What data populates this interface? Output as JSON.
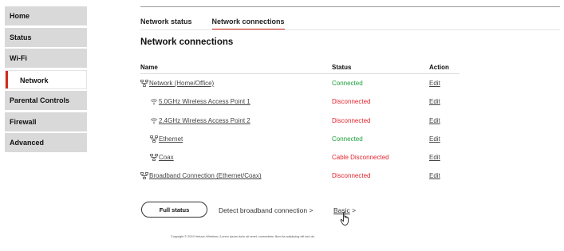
{
  "sidebar": {
    "items": [
      {
        "label": "Home"
      },
      {
        "label": "Status"
      },
      {
        "label": "Wi-Fi"
      },
      {
        "label": "Network",
        "active": true
      },
      {
        "label": "Parental Controls"
      },
      {
        "label": "Firewall"
      },
      {
        "label": "Advanced"
      }
    ]
  },
  "tabs": [
    {
      "label": "Network status"
    },
    {
      "label": "Network connections",
      "active": true
    }
  ],
  "section_title": "Network connections",
  "table": {
    "headers": {
      "name": "Name",
      "status": "Status",
      "action": "Action"
    },
    "rows": [
      {
        "name": "Network (Home/Office)",
        "icon": "network-icon",
        "status": "Connected",
        "action": "Edit"
      },
      {
        "name": "5.0GHz Wireless Access Point 1",
        "icon": "wifi-icon",
        "status": "Disconnected",
        "action": "Edit"
      },
      {
        "name": "2.4GHz Wireless Access Point 2",
        "icon": "wifi-icon",
        "status": "Disconnected",
        "action": "Edit"
      },
      {
        "name": "Ethernet",
        "icon": "network-icon",
        "status": "Connected",
        "action": "Edit"
      },
      {
        "name": "Coax",
        "icon": "network-icon",
        "status": "Cable Disconnected",
        "action": "Edit"
      },
      {
        "name": "Broadband Connection (Ethernet/Coax)",
        "icon": "network-icon",
        "status": "Disconnected",
        "action": "Edit"
      }
    ]
  },
  "footer": {
    "full_status": "Full status",
    "detect": "Detect broadband connection",
    "detect_chevron": ">",
    "basic": "Basic",
    "basic_chevron": ">",
    "copyright": "Copyright © 2019 Verizon Wireless | Lorem ipsum dolor sit amet, consectetur Illum lia adipiscing elit sed do."
  },
  "colors": {
    "accent": "#d52b1e",
    "connected": "#1d9f3a",
    "disconnected": "#e0262f",
    "sidebar_bg": "#d9d9d9"
  }
}
